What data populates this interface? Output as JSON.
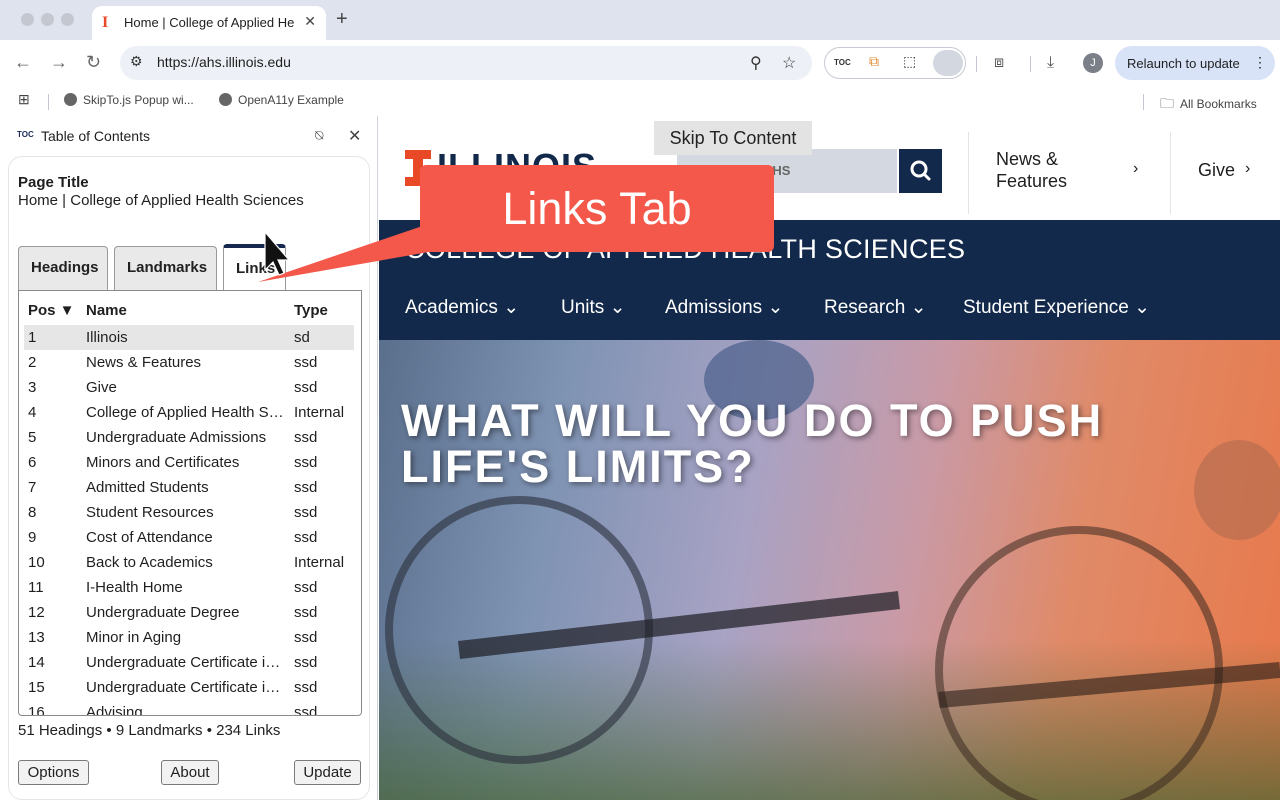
{
  "browser": {
    "tab_title": "Home | College of Applied He",
    "url": "https://ahs.illinois.edu",
    "relaunch_label": "Relaunch to update",
    "extension_toc_label": "TOC",
    "avatar_letter": "J",
    "bookmarks": [
      "SkipTo.js Popup wi...",
      "OpenA11y Example"
    ],
    "all_bookmarks": "All Bookmarks"
  },
  "side_panel": {
    "title": "Table of Contents",
    "logo": "TOC",
    "page_title_label": "Page Title",
    "page_title_value": "Home | College of Applied Health Sciences",
    "tabs": [
      "Headings",
      "Landmarks",
      "Links"
    ],
    "active_tab": "Links",
    "columns": {
      "pos": "Pos ▼",
      "name": "Name",
      "type": "Type"
    },
    "rows": [
      {
        "pos": "1",
        "name": "Illinois",
        "type": "sd"
      },
      {
        "pos": "2",
        "name": "News & Features",
        "type": "ssd"
      },
      {
        "pos": "3",
        "name": "Give",
        "type": "ssd"
      },
      {
        "pos": "4",
        "name": "College of Applied Health S…",
        "type": "Internal"
      },
      {
        "pos": "5",
        "name": "Undergraduate Admissions",
        "type": "ssd"
      },
      {
        "pos": "6",
        "name": "Minors and Certificates",
        "type": "ssd"
      },
      {
        "pos": "7",
        "name": "Admitted Students",
        "type": "ssd"
      },
      {
        "pos": "8",
        "name": "Student Resources",
        "type": "ssd"
      },
      {
        "pos": "9",
        "name": "Cost of Attendance",
        "type": "ssd"
      },
      {
        "pos": "10",
        "name": "Back to Academics",
        "type": "Internal"
      },
      {
        "pos": "11",
        "name": "I-Health Home",
        "type": "ssd"
      },
      {
        "pos": "12",
        "name": "Undergraduate Degree",
        "type": "ssd"
      },
      {
        "pos": "13",
        "name": "Minor in Aging",
        "type": "ssd"
      },
      {
        "pos": "14",
        "name": "Undergraduate Certificate in…",
        "type": "ssd"
      },
      {
        "pos": "15",
        "name": "Undergraduate Certificate in…",
        "type": "ssd"
      },
      {
        "pos": "16",
        "name": "Advising",
        "type": "ssd"
      }
    ],
    "stats": "51 Headings • 9 Landmarks • 234 Links",
    "buttons": {
      "options": "Options",
      "about": "About",
      "update": "Update"
    }
  },
  "site": {
    "logo_text": "ILLINOIS",
    "search_placeholder": "AHS",
    "skip_to_content": "Skip To Content",
    "news_features": "News &\nFeatures",
    "give": "Give",
    "college_name": "COLLEGE OF APPLIED HEALTH SCIENCES",
    "menu": [
      "Academics",
      "Units",
      "Admissions",
      "Research",
      "Student Experience"
    ],
    "hero_headline": "WHAT WILL YOU DO TO PUSH LIFE'S LIMITS?"
  },
  "callout": {
    "text": "Links Tab"
  },
  "colors": {
    "illinois_blue": "#13294b",
    "illinois_orange": "#e84a27",
    "callout": "#f4584a"
  }
}
